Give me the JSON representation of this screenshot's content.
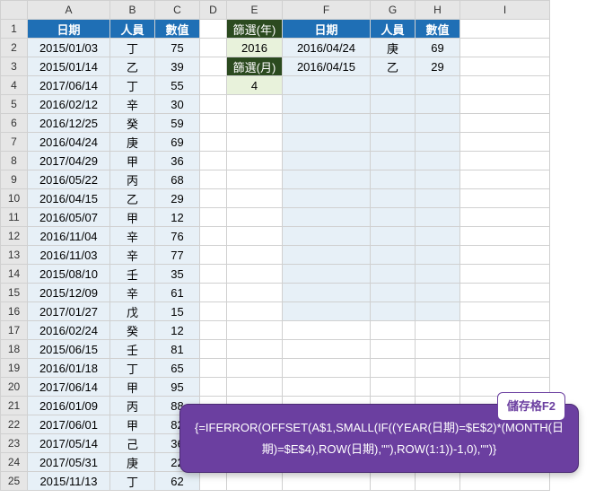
{
  "columns": [
    "A",
    "B",
    "C",
    "D",
    "E",
    "F",
    "G",
    "H",
    "I"
  ],
  "left": {
    "headers": [
      "日期",
      "人員",
      "數值"
    ],
    "rows": [
      {
        "date": "2015/01/03",
        "name": "丁",
        "val": "75"
      },
      {
        "date": "2015/01/14",
        "name": "乙",
        "val": "39"
      },
      {
        "date": "2017/06/14",
        "name": "丁",
        "val": "55"
      },
      {
        "date": "2016/02/12",
        "name": "辛",
        "val": "30"
      },
      {
        "date": "2016/12/25",
        "name": "癸",
        "val": "59"
      },
      {
        "date": "2016/04/24",
        "name": "庚",
        "val": "69"
      },
      {
        "date": "2017/04/29",
        "name": "甲",
        "val": "36"
      },
      {
        "date": "2016/05/22",
        "name": "丙",
        "val": "68"
      },
      {
        "date": "2016/04/15",
        "name": "乙",
        "val": "29"
      },
      {
        "date": "2016/05/07",
        "name": "甲",
        "val": "12"
      },
      {
        "date": "2016/11/04",
        "name": "辛",
        "val": "76"
      },
      {
        "date": "2016/11/03",
        "name": "辛",
        "val": "77"
      },
      {
        "date": "2015/08/10",
        "name": "壬",
        "val": "35"
      },
      {
        "date": "2015/12/09",
        "name": "辛",
        "val": "61"
      },
      {
        "date": "2017/01/27",
        "name": "戊",
        "val": "15"
      },
      {
        "date": "2016/02/24",
        "name": "癸",
        "val": "12"
      },
      {
        "date": "2015/06/15",
        "name": "壬",
        "val": "81"
      },
      {
        "date": "2016/01/18",
        "name": "丁",
        "val": "65"
      },
      {
        "date": "2017/06/14",
        "name": "甲",
        "val": "95"
      },
      {
        "date": "2016/01/09",
        "name": "丙",
        "val": "88"
      },
      {
        "date": "2017/06/01",
        "name": "甲",
        "val": "82"
      },
      {
        "date": "2017/05/14",
        "name": "己",
        "val": "36"
      },
      {
        "date": "2017/05/31",
        "name": "庚",
        "val": "22"
      },
      {
        "date": "2015/11/13",
        "name": "丁",
        "val": "62"
      }
    ]
  },
  "right": {
    "filter_year_label": "篩選(年)",
    "filter_year_value": "2016",
    "filter_month_label": "篩選(月)",
    "filter_month_value": "4",
    "headers": [
      "日期",
      "人員",
      "數值"
    ],
    "results": [
      {
        "date": "2016/04/24",
        "name": "庚",
        "val": "69"
      },
      {
        "date": "2016/04/15",
        "name": "乙",
        "val": "29"
      }
    ]
  },
  "tooltip": {
    "title": "儲存格F2",
    "formula": "{=IFERROR(OFFSET(A$1,SMALL(IF((YEAR(日期)=$E$2)*(MONTH(日期)=$E$4),ROW(日期),\"\"),ROW(1:1))-1,0),\"\")}"
  }
}
